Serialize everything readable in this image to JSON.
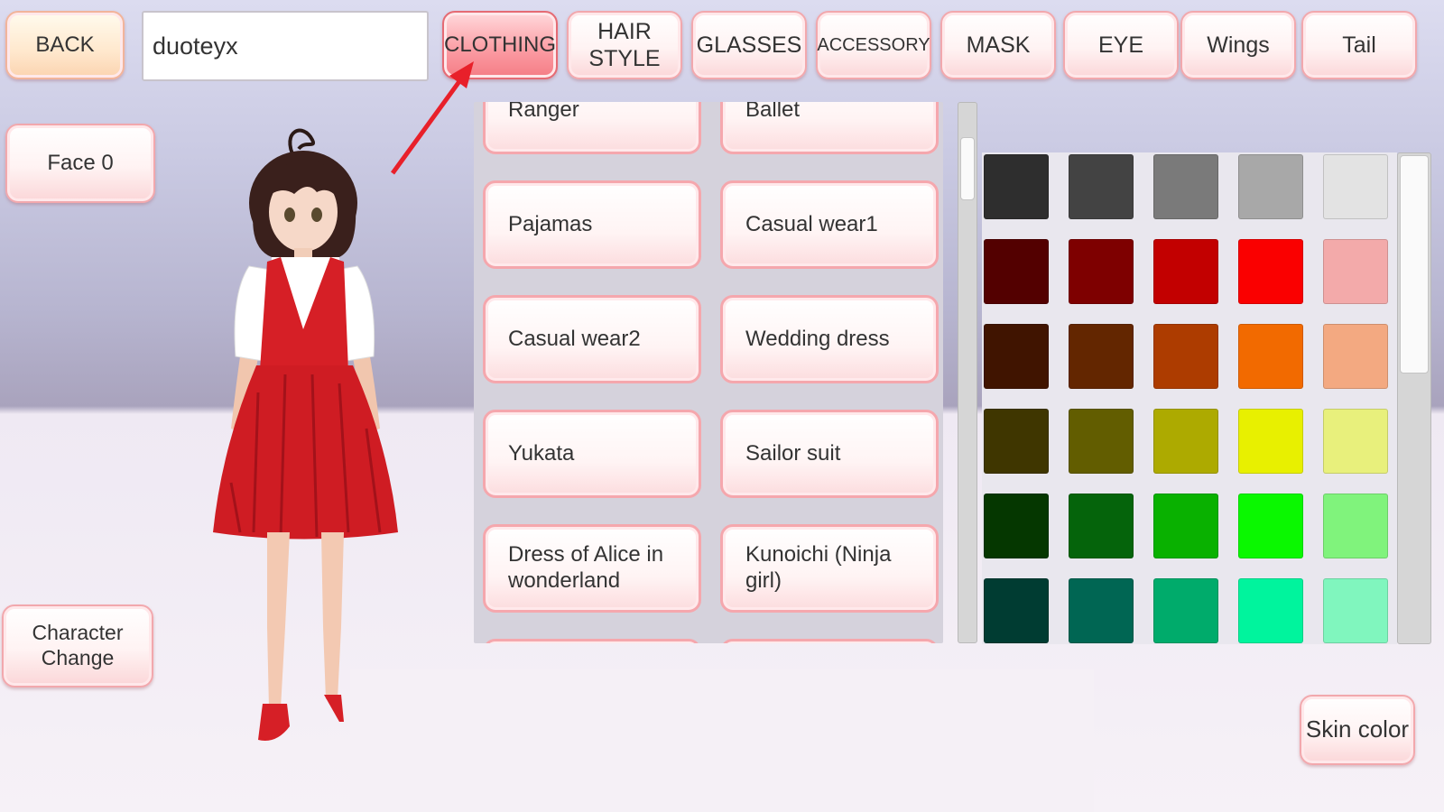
{
  "top_bar": {
    "back_label": "BACK",
    "name_value": "duoteyx",
    "tabs": [
      {
        "label": "CLOTHING",
        "active": true
      },
      {
        "label": "HAIR STYLE"
      },
      {
        "label": "GLASSES"
      },
      {
        "label": "ACCESSORY"
      },
      {
        "label": "MASK"
      },
      {
        "label": "EYE"
      },
      {
        "label": "Wings"
      },
      {
        "label": "Tail"
      }
    ]
  },
  "left": {
    "face_label": "Face 0",
    "character_change_label": "Character Change"
  },
  "clothing_list": [
    "Ranger",
    "Ballet",
    "Pajamas",
    "Casual wear1",
    "Casual wear2",
    "Wedding dress",
    "Yukata",
    "Sailor suit",
    "Dress of Alice in wonderland",
    "Kunoichi (Ninja girl)"
  ],
  "skin_color_label": "Skin color",
  "palette": [
    [
      "#2e2e2e",
      "#434343",
      "#7a7a7a",
      "#a8a8a8",
      "#e3e3e3"
    ],
    [
      "#530000",
      "#7e0000",
      "#c20000",
      "#fa0000",
      "#f3aaaa"
    ],
    [
      "#401400",
      "#632600",
      "#ad3c00",
      "#f26a00",
      "#f3a981"
    ],
    [
      "#3f3600",
      "#625d00",
      "#adaa00",
      "#e8f000",
      "#e8f07c"
    ],
    [
      "#053700",
      "#05640b",
      "#09b100",
      "#0af800",
      "#80f37c"
    ],
    [
      "#003c32",
      "#006653",
      "#00ab6b",
      "#00f49d",
      "#80f6be"
    ]
  ],
  "colors": {
    "accent": "#f47c85",
    "arrow": "#e8202a"
  }
}
